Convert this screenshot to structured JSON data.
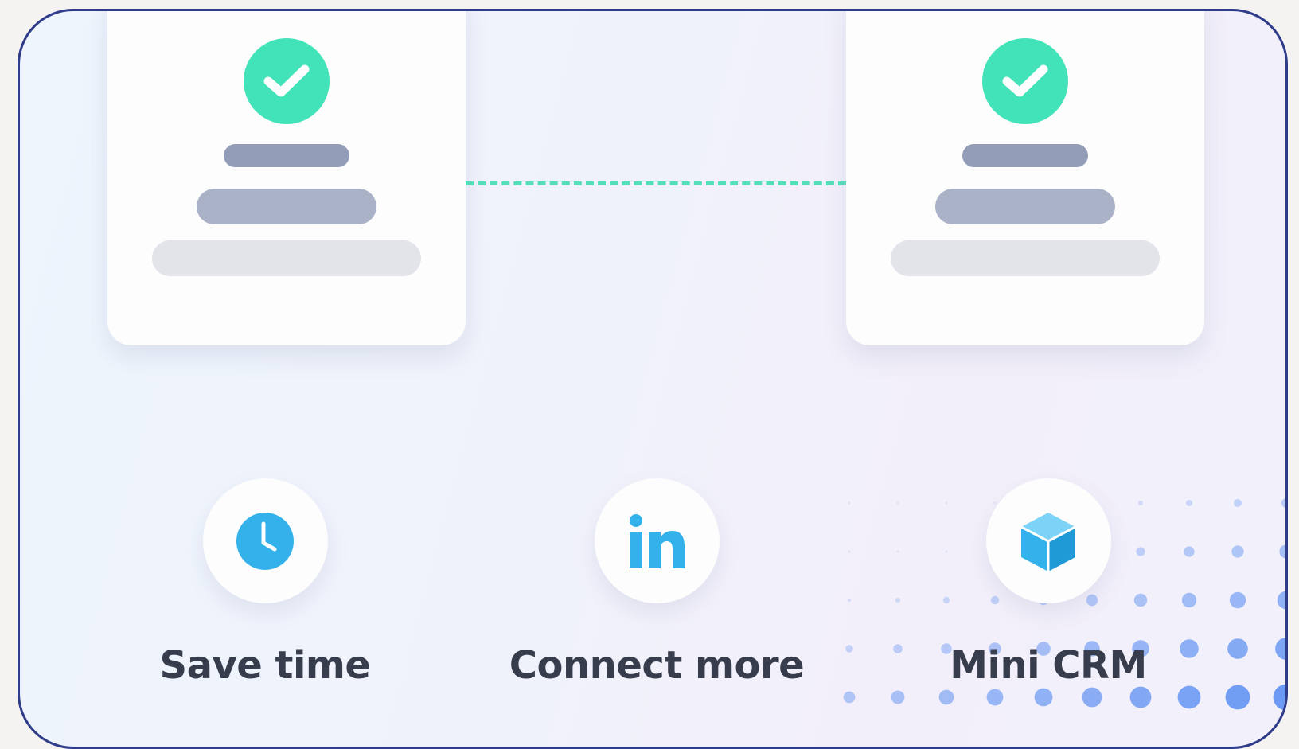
{
  "cards": [
    {
      "id": "left",
      "icon": "check-circle-icon"
    },
    {
      "id": "right",
      "icon": "check-circle-icon"
    }
  ],
  "features": [
    {
      "label": "Save time",
      "icon": "clock-icon"
    },
    {
      "label": "Connect more",
      "icon": "linkedin-icon"
    },
    {
      "label": "Mini CRM",
      "icon": "cube-icon"
    }
  ],
  "colors": {
    "frame_border": "#2f3c8a",
    "check_green": "#43e3b9",
    "connector": "#55dfb9",
    "icon_blue": "#33b1ea",
    "dot_blue": "#3d7cf0",
    "label_text": "#373d4c"
  }
}
